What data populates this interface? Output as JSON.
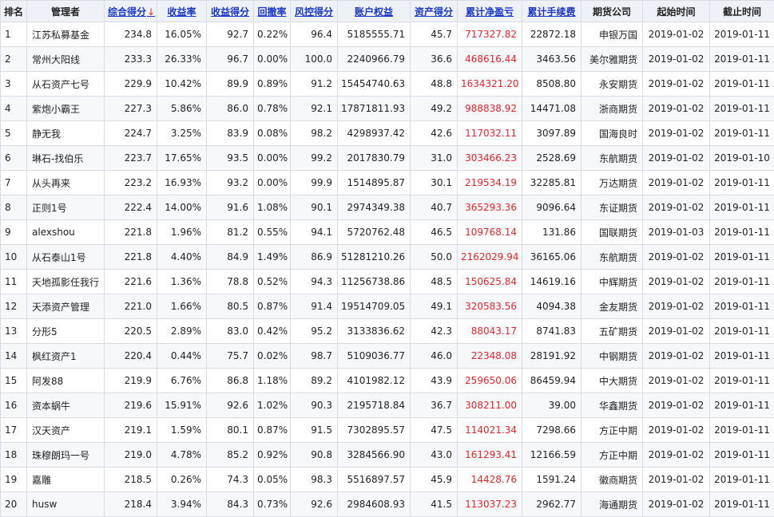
{
  "headers": [
    {
      "key": "rank",
      "label": "排名",
      "link": false
    },
    {
      "key": "manager",
      "label": "管理者",
      "link": false
    },
    {
      "key": "score",
      "label": "综合得分",
      "link": true,
      "sort": "↓"
    },
    {
      "key": "return",
      "label": "收益率",
      "link": true
    },
    {
      "key": "return_score",
      "label": "收益得分",
      "link": true
    },
    {
      "key": "drawdown",
      "label": "回撤率",
      "link": true
    },
    {
      "key": "risk_score",
      "label": "风控得分",
      "link": true
    },
    {
      "key": "equity",
      "label": "账户权益",
      "link": true
    },
    {
      "key": "asset_score",
      "label": "资产得分",
      "link": true
    },
    {
      "key": "pnl",
      "label": "累计净盈亏",
      "link": true
    },
    {
      "key": "fee",
      "label": "累计手续费",
      "link": true
    },
    {
      "key": "company",
      "label": "期货公司",
      "link": false
    },
    {
      "key": "start",
      "label": "起始时间",
      "link": false
    },
    {
      "key": "end",
      "label": "截止时间",
      "link": false
    }
  ],
  "rows": [
    [
      "1",
      "江苏私募基金",
      "234.8",
      "16.05%",
      "92.7",
      "0.22%",
      "96.4",
      "5185555.71",
      "45.7",
      "717327.82",
      "22872.18",
      "申银万国",
      "2019-01-02",
      "2019-01-11"
    ],
    [
      "2",
      "常州大阳线",
      "233.3",
      "26.33%",
      "96.7",
      "0.00%",
      "100.0",
      "2240966.79",
      "36.6",
      "468616.44",
      "3463.56",
      "美尔雅期货",
      "2019-01-02",
      "2019-01-11"
    ],
    [
      "3",
      "从石资产七号",
      "229.9",
      "10.42%",
      "89.9",
      "0.89%",
      "91.2",
      "15454740.63",
      "48.8",
      "1634321.20",
      "8508.80",
      "永安期货",
      "2019-01-02",
      "2019-01-11"
    ],
    [
      "4",
      "紫炮小霸王",
      "227.3",
      "5.86%",
      "86.0",
      "0.78%",
      "92.1",
      "17871811.93",
      "49.2",
      "988838.92",
      "14471.08",
      "浙商期货",
      "2019-01-02",
      "2019-01-11"
    ],
    [
      "5",
      "静无我",
      "224.7",
      "3.25%",
      "83.9",
      "0.08%",
      "98.2",
      "4298937.42",
      "42.6",
      "117032.11",
      "3097.89",
      "国海良时",
      "2019-01-02",
      "2019-01-11"
    ],
    [
      "6",
      "琳石-找伯乐",
      "223.7",
      "17.65%",
      "93.5",
      "0.00%",
      "99.2",
      "2017830.79",
      "31.0",
      "303466.23",
      "2528.69",
      "东航期货",
      "2019-01-02",
      "2019-01-10"
    ],
    [
      "7",
      "从头再来",
      "223.2",
      "16.93%",
      "93.2",
      "0.00%",
      "99.9",
      "1514895.87",
      "30.1",
      "219534.19",
      "32285.81",
      "万达期货",
      "2019-01-02",
      "2019-01-11"
    ],
    [
      "8",
      "正则1号",
      "222.4",
      "14.00%",
      "91.6",
      "1.08%",
      "90.1",
      "2974349.38",
      "40.7",
      "365293.36",
      "9096.64",
      "东证期货",
      "2019-01-02",
      "2019-01-11"
    ],
    [
      "9",
      "alexshou",
      "221.8",
      "1.96%",
      "81.2",
      "0.55%",
      "94.1",
      "5720762.48",
      "46.5",
      "109768.14",
      "131.86",
      "国联期货",
      "2019-01-03",
      "2019-01-11"
    ],
    [
      "10",
      "从石泰山1号",
      "221.8",
      "4.40%",
      "84.9",
      "1.49%",
      "86.9",
      "51281210.26",
      "50.0",
      "2162029.94",
      "36165.06",
      "东航期货",
      "2019-01-02",
      "2019-01-11"
    ],
    [
      "11",
      "天地孤影任我行",
      "221.6",
      "1.36%",
      "78.8",
      "0.52%",
      "94.3",
      "11256738.86",
      "48.5",
      "150625.84",
      "14619.16",
      "中辉期货",
      "2019-01-02",
      "2019-01-11"
    ],
    [
      "12",
      "天添资产管理",
      "221.0",
      "1.66%",
      "80.5",
      "0.87%",
      "91.4",
      "19514709.05",
      "49.1",
      "320583.56",
      "4094.38",
      "金友期货",
      "2019-01-02",
      "2019-01-11"
    ],
    [
      "13",
      "分形5",
      "220.5",
      "2.89%",
      "83.0",
      "0.42%",
      "95.2",
      "3133836.62",
      "42.3",
      "88043.17",
      "8741.83",
      "五矿期货",
      "2019-01-02",
      "2019-01-11"
    ],
    [
      "14",
      "枫红资产1",
      "220.4",
      "0.44%",
      "75.7",
      "0.02%",
      "98.7",
      "5109036.77",
      "46.0",
      "22348.08",
      "28191.92",
      "中钢期货",
      "2019-01-02",
      "2019-01-11"
    ],
    [
      "15",
      "阿发88",
      "219.9",
      "6.76%",
      "86.8",
      "1.18%",
      "89.2",
      "4101982.12",
      "43.9",
      "259650.06",
      "86459.94",
      "中大期货",
      "2019-01-02",
      "2019-01-11"
    ],
    [
      "16",
      "资本蜗牛",
      "219.6",
      "15.91%",
      "92.6",
      "1.02%",
      "90.3",
      "2195718.84",
      "36.7",
      "308211.00",
      "39.00",
      "华鑫期货",
      "2019-01-02",
      "2019-01-11"
    ],
    [
      "17",
      "汉天资产",
      "219.1",
      "1.59%",
      "80.1",
      "0.87%",
      "91.5",
      "7302895.57",
      "47.5",
      "114021.34",
      "7298.66",
      "方正中期",
      "2019-01-02",
      "2019-01-11"
    ],
    [
      "18",
      "珠穆朗玛一号",
      "219.0",
      "4.78%",
      "85.2",
      "0.92%",
      "90.8",
      "3284566.90",
      "43.0",
      "161293.41",
      "12166.59",
      "方正中期",
      "2019-01-02",
      "2019-01-11"
    ],
    [
      "19",
      "嘉雕",
      "218.5",
      "0.26%",
      "74.3",
      "0.05%",
      "98.3",
      "5516897.57",
      "45.9",
      "14428.76",
      "1591.24",
      "徽商期货",
      "2019-01-02",
      "2019-01-11"
    ],
    [
      "20",
      "husw",
      "218.4",
      "3.94%",
      "84.3",
      "0.73%",
      "92.6",
      "2984608.93",
      "41.5",
      "113037.23",
      "2962.77",
      "海通期货",
      "2019-01-02",
      "2019-01-11"
    ]
  ],
  "colors": {
    "link": "#1a37c8",
    "pnl": "#e0262b",
    "header_bg": "#eef1f6"
  }
}
